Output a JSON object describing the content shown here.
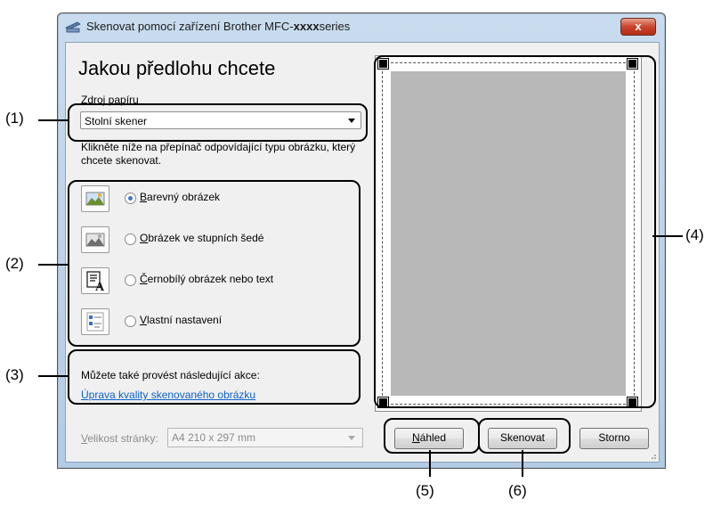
{
  "window": {
    "title_prefix": "Skenovat pomocí zařízení Brother MFC-",
    "title_model": "xxxx",
    "title_suffix": "series",
    "close_label": "x"
  },
  "main": {
    "heading": "Jakou předlohu chcete",
    "source_label": "Zdroj papíru",
    "source_value": "Stolní skener",
    "instruction": "Klikněte níže na přepínač odpovídající typu obrázku, který chcete skenovat.",
    "options": [
      {
        "first": "B",
        "rest": "arevný obrázek",
        "selected": true
      },
      {
        "first": "O",
        "rest": "brázek ve stupních šedé",
        "selected": false
      },
      {
        "first": "Č",
        "rest": "ernobílý obrázek nebo text",
        "selected": false
      },
      {
        "first": "V",
        "rest": "lastní nastavení",
        "selected": false
      }
    ],
    "actions_hint": "Můžete také provést následující akce:",
    "actions_link": "Úprava kvality skenovaného obrázku",
    "page_size_label_first": "V",
    "page_size_label_rest": "elikost stránky:",
    "page_size_value": "A4 210 x 297 mm"
  },
  "buttons": {
    "preview_first": "N",
    "preview_rest": "áhled",
    "scan": "Skenovat",
    "cancel": "Storno"
  },
  "callouts": {
    "c1": "(1)",
    "c2": "(2)",
    "c3": "(3)",
    "c4": "(4)",
    "c5": "(5)",
    "c6": "(6)"
  }
}
